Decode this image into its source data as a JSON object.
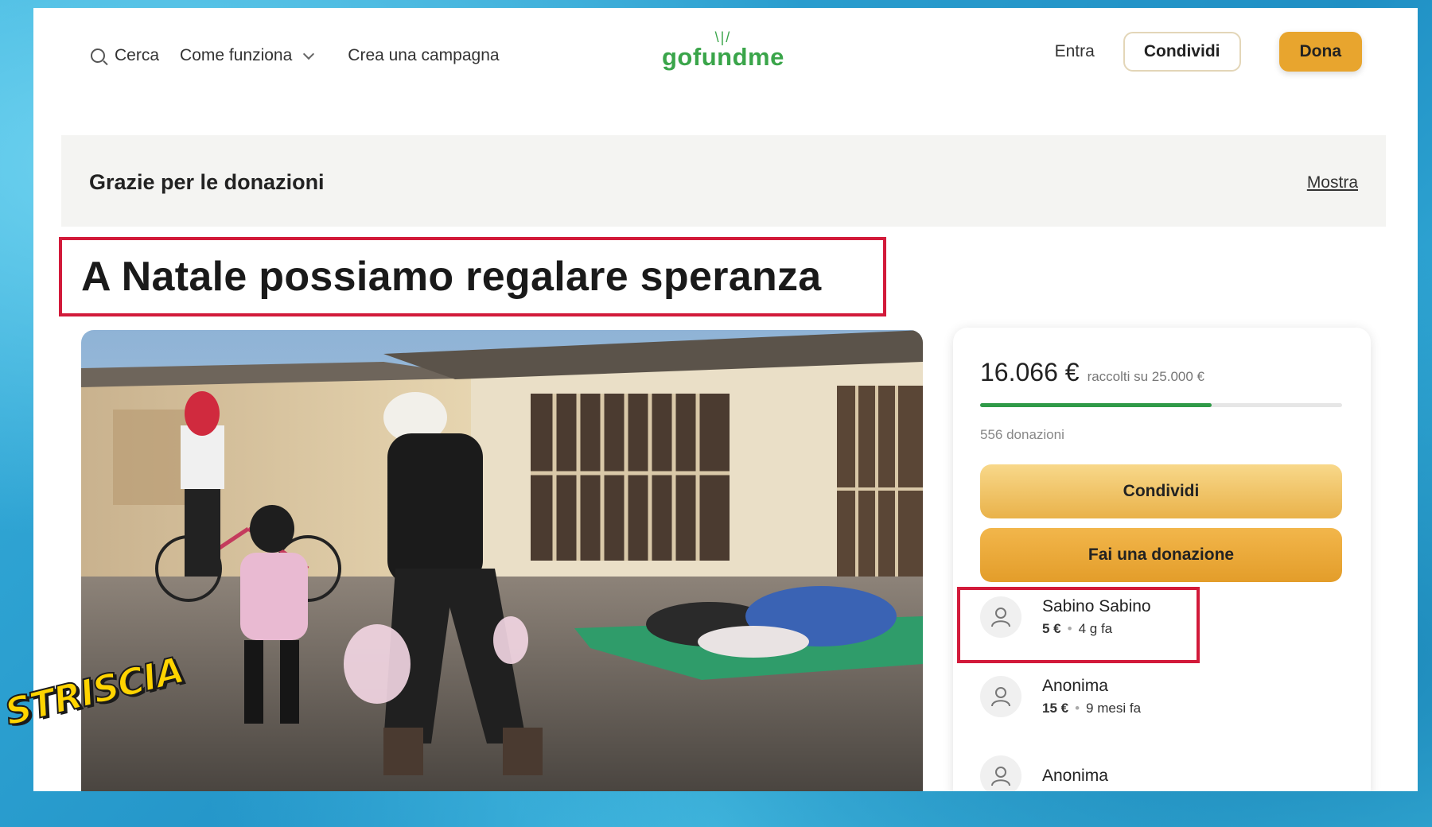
{
  "header": {
    "search_label": "Cerca",
    "how_it_works_label": "Come funziona",
    "create_campaign_label": "Crea una campagna",
    "logo_text": "gofundme",
    "login_label": "Entra",
    "share_label": "Condividi",
    "donate_label": "Dona"
  },
  "thanks_bar": {
    "text": "Grazie per le donazioni",
    "show_label": "Mostra"
  },
  "campaign": {
    "title": "A Natale possiamo regalare speranza"
  },
  "donation_card": {
    "raised_amount": "16.066 €",
    "goal_text": "raccolti su 25.000 €",
    "progress_fraction": 0.64,
    "donation_count": "556 donazioni",
    "share_button": "Condividi",
    "donate_button": "Fai una donazione",
    "donors": [
      {
        "name": "Sabino Sabino",
        "amount": "5 €",
        "time": "4 g fa"
      },
      {
        "name": "Anonima",
        "amount": "15 €",
        "time": "9 mesi fa"
      },
      {
        "name": "Anonima",
        "amount": "",
        "time": ""
      }
    ]
  },
  "overlay": {
    "logo_text": "STRISCIA"
  },
  "colors": {
    "brand_green": "#3aa54a",
    "accent_orange": "#e8a52e",
    "highlight_red": "#d21a3a",
    "frame_blue": "#2fa3cf"
  }
}
